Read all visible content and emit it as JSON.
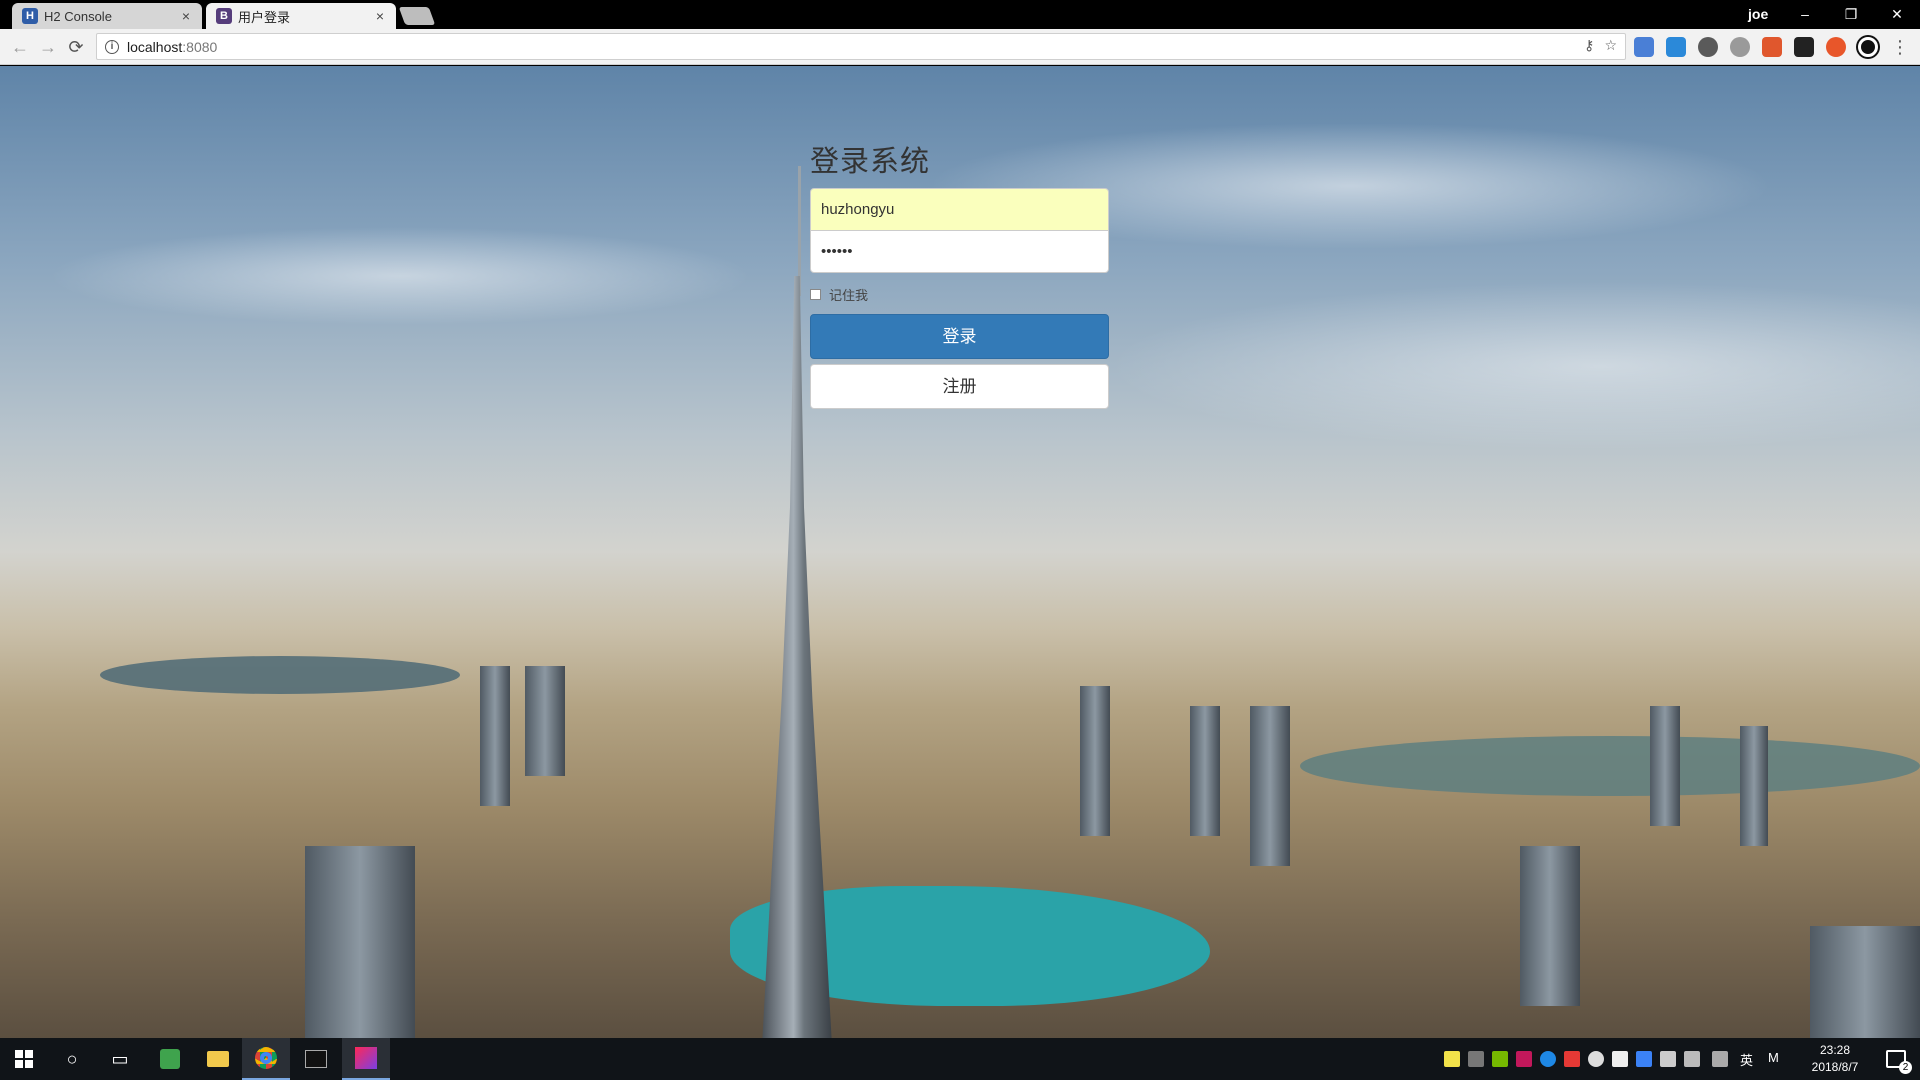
{
  "browser": {
    "tabs": [
      {
        "favicon": "H",
        "title": "H2 Console",
        "close": "×"
      },
      {
        "favicon": "B",
        "title": "用户登录",
        "close": "×"
      }
    ],
    "profile_name": "joe",
    "window_controls": {
      "minimize": "–",
      "restore": "❐",
      "close": "✕"
    },
    "nav": {
      "back": "←",
      "forward": "→",
      "reload": "⟳"
    },
    "address": {
      "host": "localhost",
      "port": ":8080",
      "info_icon": "i"
    },
    "omnibox_icons": {
      "key": "⚷",
      "star": "☆"
    },
    "menu_icon": "⋮"
  },
  "login": {
    "title": "登录系统",
    "username_value": "huzhongyu",
    "password_value": "••••••",
    "remember_label": "记住我",
    "login_button": "登录",
    "register_button": "注册"
  },
  "colors": {
    "primary": "#337ab7",
    "autofill": "#faffbd"
  },
  "taskbar": {
    "start_icon": "windows-logo",
    "search_icon": "○",
    "task_view_icon": "▭",
    "language": "英",
    "ime": "M",
    "time": "23:28",
    "date": "2018/8/7",
    "notifications_count": "2"
  }
}
